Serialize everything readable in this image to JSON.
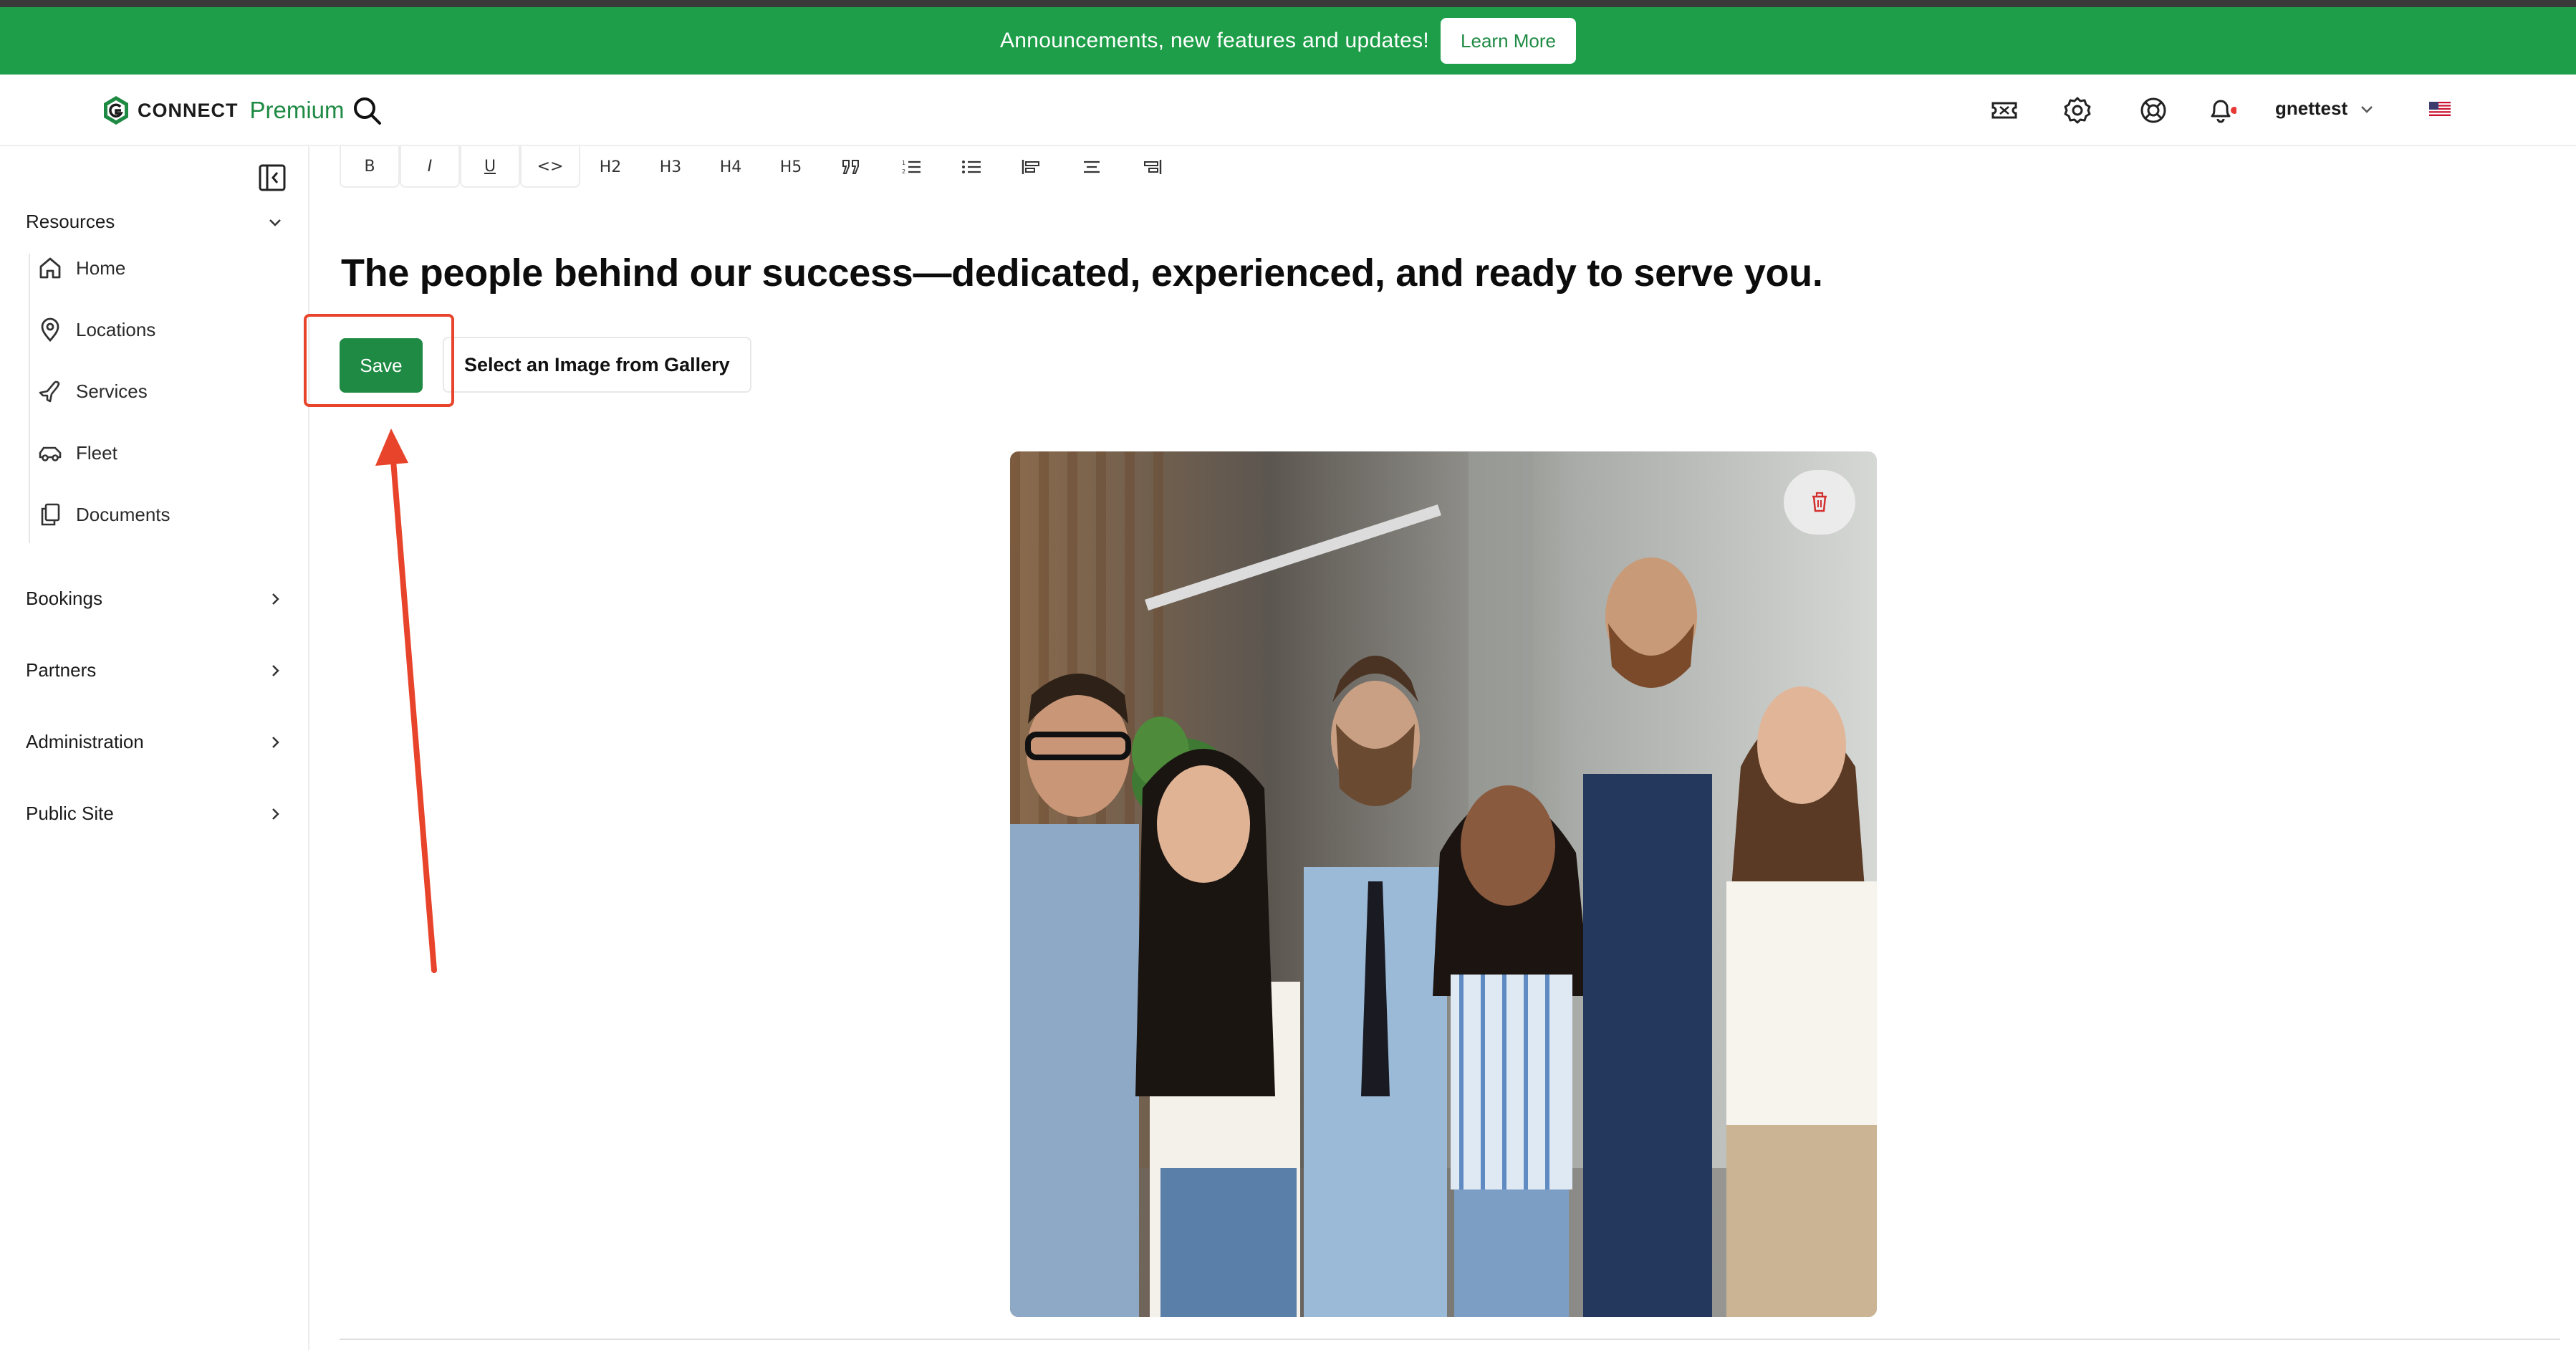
{
  "banner": {
    "text": "Announcements, new features and updates!",
    "button_label": "Learn More"
  },
  "header": {
    "brand_name": "CONNECT",
    "brand_tier": "Premium",
    "username": "gnettest",
    "icons": [
      "search-icon",
      "ticket-icon",
      "gear-icon",
      "lifebuoy-icon",
      "bell-icon",
      "chevron-down-icon",
      "us-flag-icon"
    ]
  },
  "sidebar": {
    "sections": [
      {
        "label": "Resources",
        "expanded": true
      },
      {
        "label": "Bookings",
        "expanded": false
      },
      {
        "label": "Partners",
        "expanded": false
      },
      {
        "label": "Administration",
        "expanded": false
      },
      {
        "label": "Public Site",
        "expanded": false
      }
    ],
    "resources_items": [
      {
        "label": "Home",
        "icon": "home-icon"
      },
      {
        "label": "Locations",
        "icon": "map-pin-icon"
      },
      {
        "label": "Services",
        "icon": "plane-icon"
      },
      {
        "label": "Fleet",
        "icon": "car-icon"
      },
      {
        "label": "Documents",
        "icon": "documents-icon"
      }
    ]
  },
  "toolbar": {
    "buttons": [
      "B",
      "I",
      "U",
      "<>",
      "H2",
      "H3",
      "H4",
      "H5",
      "quote",
      "ordered-list",
      "bullet-list",
      "align-left",
      "align-center",
      "align-right"
    ]
  },
  "editor": {
    "title": "The people behind our success—dedicated, experienced, and ready to serve you.",
    "save_label": "Save",
    "gallery_label": "Select an Image from Gallery"
  },
  "colors": {
    "brand_green": "#1e9e49",
    "button_green": "#1e8a43",
    "annotation_red": "#e8442b",
    "notification_dot": "#e53935"
  }
}
